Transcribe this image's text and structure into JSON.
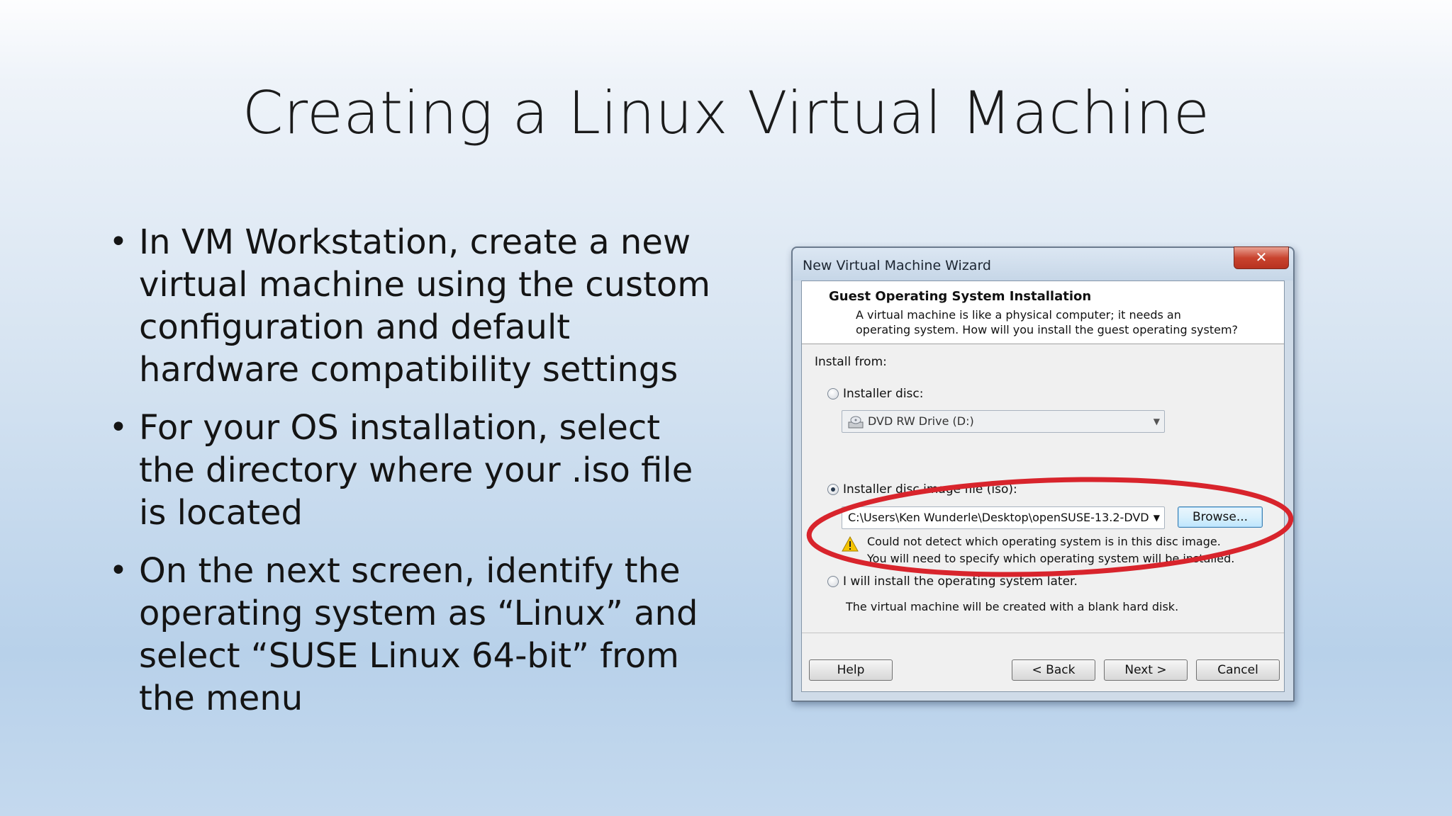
{
  "slide": {
    "title": "Creating a Linux Virtual Machine",
    "bullet_marker": "•",
    "bullets": [
      "In VM Workstation, create a new virtual machine using the custom configuration and default hardware compatibility settings",
      "For your OS installation, select the directory where your .iso file is located",
      "On the next screen, identify the operating system as “Linux” and select “SUSE Linux 64-bit” from the menu"
    ]
  },
  "dialog": {
    "window_title": "New Virtual Machine Wizard",
    "close_glyph": "✕",
    "header_title": "Guest Operating System Installation",
    "header_description": "A virtual machine is like a physical computer; it needs an operating system. How will you install the guest operating system?",
    "install_from_label": "Install from:",
    "option_disc_label": "Installer disc:",
    "disc_drive_value": "DVD RW Drive (D:)",
    "option_iso_label": "Installer disc image file (iso):",
    "iso_path_value": "C:\\Users\\Ken Wunderle\\Desktop\\openSUSE-13.2-DVD",
    "browse_label": "Browse...",
    "warning_line1": "Could not detect which operating system is in this disc image.",
    "warning_line2": "You will need to specify which operating system will be installed.",
    "option_later_label": "I will install the operating system later.",
    "later_description": "The virtual machine will be created with a blank hard disk.",
    "selected_option": "iso",
    "buttons": {
      "help": "Help",
      "back": "< Back",
      "next": "Next >",
      "cancel": "Cancel"
    }
  },
  "annotation": {
    "highlight_color": "#d8242c"
  }
}
